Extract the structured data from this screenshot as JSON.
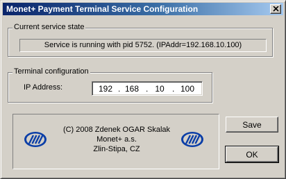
{
  "window": {
    "title": "Monet+ Payment Terminal Service Configuration"
  },
  "service_state": {
    "group_label": "Current service state",
    "status_text": "Service is running with pid 5752. (IPAddr=192.168.10.100)"
  },
  "terminal_config": {
    "group_label": "Terminal configuration",
    "ip_label": "IP Address:",
    "ip_octets": [
      "192",
      "168",
      "10",
      "100"
    ],
    "separator": "."
  },
  "credits": {
    "line1": "(C) 2008 Zdenek OGAR Skalak",
    "line2": "Monet+ a.s.",
    "line3": "Zlin-Stipa, CZ"
  },
  "buttons": {
    "save_label": "Save",
    "ok_label": "OK"
  },
  "colors": {
    "title_gradient_start": "#0a246a",
    "title_gradient_end": "#a6caf0",
    "dialog_face": "#d4d0c8",
    "logo_blue": "#0b3ea7"
  }
}
